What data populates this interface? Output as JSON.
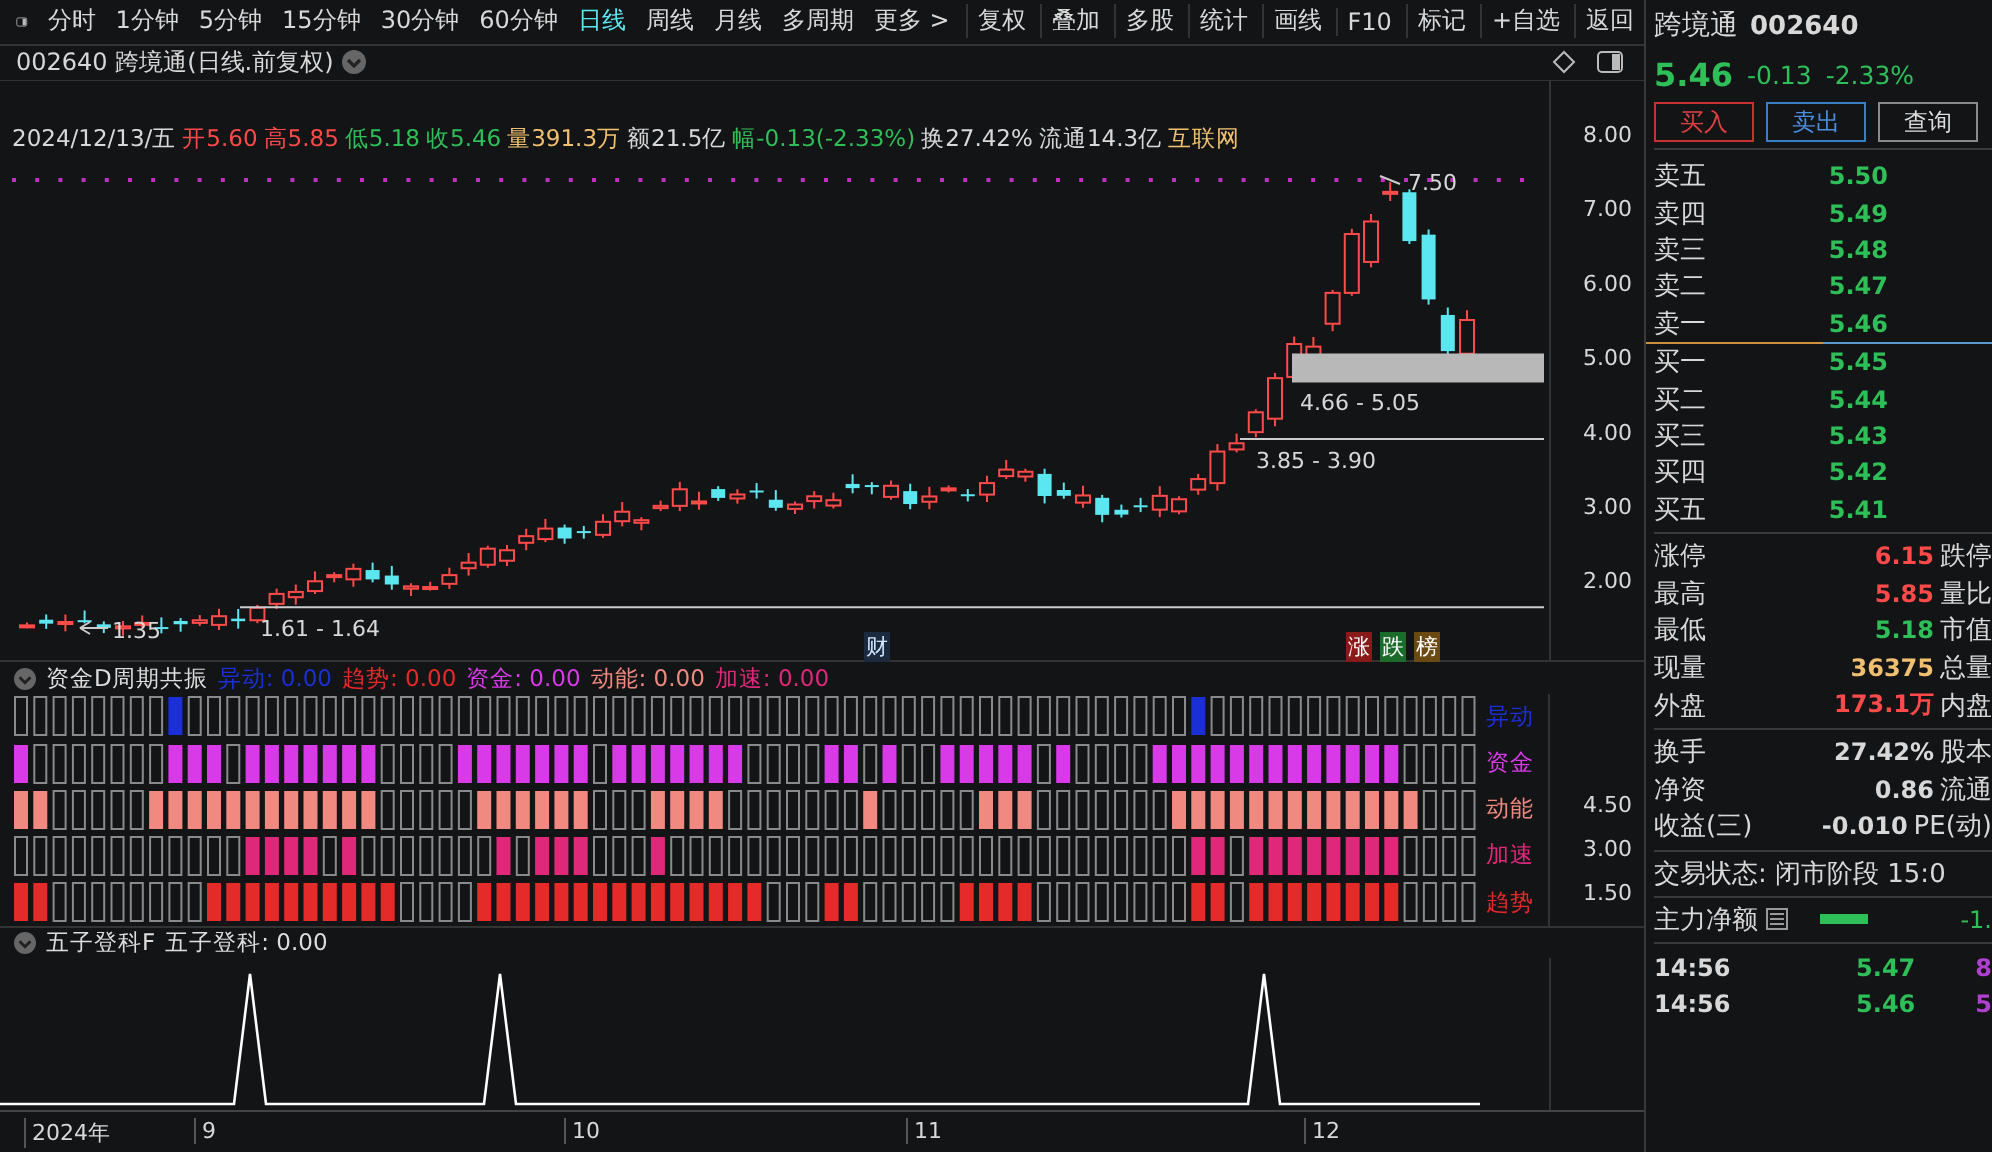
{
  "toolbar": {
    "periods": [
      {
        "label": "分时",
        "selected": false
      },
      {
        "label": "1分钟",
        "selected": false
      },
      {
        "label": "5分钟",
        "selected": false
      },
      {
        "label": "15分钟",
        "selected": false
      },
      {
        "label": "30分钟",
        "selected": false
      },
      {
        "label": "60分钟",
        "selected": false
      },
      {
        "label": "日线",
        "selected": true
      },
      {
        "label": "周线",
        "selected": false
      },
      {
        "label": "月线",
        "selected": false
      },
      {
        "label": "多周期",
        "selected": false
      },
      {
        "label": "更多 >",
        "selected": false
      }
    ],
    "actions": [
      "复权",
      "叠加",
      "多股",
      "统计",
      "画线",
      "F10",
      "标记",
      "+自选",
      "返回"
    ]
  },
  "chart_title": "002640 跨境通(日线.前复权)",
  "quote_line": [
    {
      "text": "2024/12/13/五",
      "kind": "neutral"
    },
    {
      "text": "开5.60",
      "kind": "up"
    },
    {
      "text": "高5.85",
      "kind": "up"
    },
    {
      "text": "低5.18",
      "kind": "down"
    },
    {
      "text": "收5.46",
      "kind": "down"
    },
    {
      "text": "量391.3万",
      "kind": "volume"
    },
    {
      "text": "额21.5亿",
      "kind": "neutral"
    },
    {
      "text": "幅-0.13(-2.33%)",
      "kind": "down"
    },
    {
      "text": "换27.42%",
      "kind": "neutral"
    },
    {
      "text": "流通14.3亿",
      "kind": "neutral"
    },
    {
      "text": "互联网",
      "kind": "volume"
    }
  ],
  "price_axis": [
    "8.00",
    "7.00",
    "6.00",
    "5.00",
    "4.00",
    "3.00",
    "2.00"
  ],
  "annotations": {
    "high": "7.50",
    "low": "1.35",
    "zones": [
      "4.66 - 5.05",
      "3.85 - 3.90",
      "1.61 - 1.64"
    ],
    "event": "财",
    "badges": [
      {
        "text": "涨",
        "color": "#8a1a1a"
      },
      {
        "text": "跌",
        "color": "#1d6b2a"
      },
      {
        "text": "榜",
        "color": "#6b4a12"
      }
    ]
  },
  "indicator": {
    "name": "资金D周期共振",
    "values": [
      {
        "text": "异动: 0.00",
        "color": "#1b2fd6"
      },
      {
        "text": "趋势: 0.00",
        "color": "#e52a2a"
      },
      {
        "text": "资金: 0.00",
        "color": "#d83ae8"
      },
      {
        "text": "动能: 0.00",
        "color": "#f08a80"
      },
      {
        "text": "加速: 0.00",
        "color": "#e0287a"
      }
    ],
    "rows": [
      {
        "label": "异动",
        "color": "#1b2fd6",
        "filled": [
          false,
          false,
          false,
          false,
          false,
          false,
          false,
          false,
          true,
          false,
          false,
          false,
          false,
          false,
          false,
          false,
          false,
          false,
          false,
          false,
          false,
          false,
          false,
          false,
          false,
          false,
          false,
          false,
          false,
          false,
          false,
          false,
          false,
          false,
          false,
          false,
          false,
          false,
          false,
          false,
          false,
          false,
          false,
          false,
          false,
          false,
          false,
          false,
          false,
          false,
          false,
          false,
          false,
          false,
          false,
          false,
          false,
          false,
          false,
          false,
          false,
          true,
          false,
          false,
          false,
          false,
          false,
          false,
          false,
          false,
          false,
          false,
          false,
          false,
          false,
          false
        ]
      },
      {
        "label": "资金",
        "color": "#d83ae8",
        "filled": [
          true,
          false,
          false,
          false,
          false,
          false,
          false,
          false,
          true,
          true,
          true,
          false,
          true,
          true,
          true,
          true,
          true,
          true,
          true,
          false,
          false,
          false,
          false,
          true,
          true,
          true,
          true,
          true,
          true,
          true,
          false,
          true,
          true,
          true,
          true,
          true,
          true,
          true,
          false,
          false,
          false,
          false,
          true,
          true,
          false,
          true,
          false,
          false,
          true,
          true,
          true,
          true,
          true,
          false,
          true,
          false,
          false,
          false,
          false,
          true,
          true,
          true,
          true,
          true,
          true,
          true,
          true,
          true,
          true,
          true,
          true,
          true,
          false,
          false,
          false,
          false
        ]
      },
      {
        "label": "动能",
        "color": "#f08a80",
        "filled": [
          true,
          true,
          false,
          false,
          false,
          false,
          false,
          true,
          true,
          true,
          true,
          true,
          true,
          true,
          true,
          true,
          true,
          true,
          true,
          false,
          false,
          false,
          false,
          false,
          true,
          true,
          true,
          true,
          true,
          true,
          false,
          false,
          false,
          true,
          true,
          true,
          true,
          false,
          false,
          false,
          false,
          false,
          false,
          false,
          true,
          false,
          false,
          false,
          false,
          false,
          true,
          true,
          true,
          false,
          false,
          false,
          false,
          false,
          false,
          false,
          true,
          true,
          true,
          true,
          true,
          true,
          true,
          true,
          true,
          true,
          true,
          true,
          true,
          false,
          false,
          false
        ]
      },
      {
        "label": "加速",
        "color": "#e0287a",
        "filled": [
          false,
          false,
          false,
          false,
          false,
          false,
          false,
          false,
          false,
          false,
          false,
          false,
          true,
          true,
          true,
          true,
          false,
          true,
          false,
          false,
          false,
          false,
          false,
          false,
          false,
          true,
          false,
          true,
          true,
          true,
          false,
          false,
          false,
          true,
          false,
          false,
          false,
          false,
          false,
          false,
          false,
          false,
          false,
          false,
          false,
          false,
          false,
          false,
          false,
          false,
          false,
          false,
          false,
          false,
          false,
          false,
          false,
          false,
          false,
          false,
          false,
          true,
          true,
          false,
          true,
          true,
          true,
          true,
          true,
          true,
          true,
          true,
          false,
          false,
          false,
          false
        ]
      },
      {
        "label": "趋势",
        "color": "#e52a2a",
        "filled": [
          true,
          true,
          false,
          false,
          false,
          false,
          false,
          false,
          false,
          false,
          true,
          true,
          true,
          true,
          true,
          true,
          true,
          true,
          true,
          true,
          false,
          false,
          false,
          false,
          true,
          true,
          true,
          true,
          true,
          true,
          true,
          true,
          true,
          true,
          true,
          true,
          true,
          true,
          true,
          false,
          false,
          false,
          true,
          true,
          false,
          false,
          false,
          false,
          false,
          true,
          true,
          true,
          true,
          false,
          false,
          false,
          false,
          false,
          false,
          false,
          false,
          true,
          true,
          false,
          true,
          true,
          true,
          true,
          true,
          true,
          true,
          true,
          false,
          false,
          false,
          false
        ]
      }
    ],
    "axis": [
      "4.50",
      "3.00",
      "1.50"
    ]
  },
  "indicator2": {
    "name": "五子登科F",
    "value": "五子登科: 0.00"
  },
  "time_axis": [
    "2024年",
    "9",
    "10",
    "11",
    "12"
  ],
  "quote": {
    "name": "跨境通",
    "code": "002640",
    "price": "5.46",
    "change": "-0.13",
    "percent": "-2.33%"
  },
  "buttons": [
    {
      "label": "买入",
      "kind": "buy"
    },
    {
      "label": "卖出",
      "kind": "sell"
    },
    {
      "label": "查询",
      "kind": "query"
    }
  ],
  "asks": [
    {
      "label": "卖五",
      "price": "5.50"
    },
    {
      "label": "卖四",
      "price": "5.49"
    },
    {
      "label": "卖三",
      "price": "5.48"
    },
    {
      "label": "卖二",
      "price": "5.47"
    },
    {
      "label": "卖一",
      "price": "5.46"
    }
  ],
  "bids": [
    {
      "label": "买一",
      "price": "5.45"
    },
    {
      "label": "买二",
      "price": "5.44"
    },
    {
      "label": "买三",
      "price": "5.43"
    },
    {
      "label": "买四",
      "price": "5.42"
    },
    {
      "label": "买五",
      "price": "5.41"
    }
  ],
  "stats": [
    {
      "label": "涨停",
      "value": "6.15",
      "kind": "up",
      "label2": "跌停"
    },
    {
      "label": "最高",
      "value": "5.85",
      "kind": "up",
      "label2": "量比"
    },
    {
      "label": "最低",
      "value": "5.18",
      "kind": "down",
      "label2": "市值"
    },
    {
      "label": "现量",
      "value": "36375",
      "kind": "volume",
      "label2": "总量"
    },
    {
      "label": "外盘",
      "value": "173.1万",
      "kind": "up",
      "label2": "内盘"
    }
  ],
  "stats2": [
    {
      "label": "换手",
      "value": "27.42%",
      "label2": "股本"
    },
    {
      "label": "净资",
      "value": "0.86",
      "label2": "流通"
    },
    {
      "label": "收益(三)",
      "value": "-0.010",
      "label2": "PE(动)"
    }
  ],
  "trade_status": "交易状态: 闭市阶段 15:0",
  "main_force": {
    "label": "主力净额",
    "value": "-1."
  },
  "ticks": [
    {
      "time": "14:56",
      "price": "5.47",
      "volume": "8"
    },
    {
      "time": "14:56",
      "price": "5.46",
      "volume": "5"
    }
  ]
}
